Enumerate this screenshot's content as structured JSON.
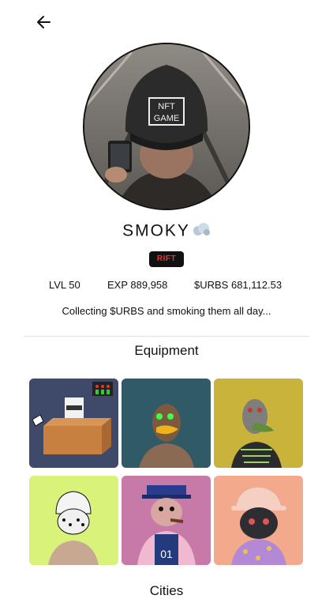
{
  "header": {
    "back_icon": "arrow-left-icon"
  },
  "profile": {
    "avatar_text": "NFT GAME",
    "username": "SMOKY",
    "username_icon": "smoke-cloud-icon",
    "badge": "RIFT",
    "badge_color": "#e53935",
    "level": "LVL 50",
    "exp": "EXP 889,958",
    "urbs": "$URBS 681,112.53",
    "bio": "Collecting $URBS and smoking them all day..."
  },
  "equipment": {
    "title": "Equipment",
    "items": [
      {
        "name": "box-robot-nft",
        "bg": "#3f4a6b"
      },
      {
        "name": "duck-nft-green-eyes",
        "bg": "#2f5a66"
      },
      {
        "name": "zombie-duck-nft",
        "bg": "#c9b33a"
      },
      {
        "name": "bandana-duck-nft",
        "bg": "#d8f27a"
      },
      {
        "name": "captain-duck-nft",
        "bg": "#c77aa8"
      },
      {
        "name": "cat-bucket-hat-nft",
        "bg": "#f2a98c"
      }
    ]
  },
  "cities": {
    "title": "Cities"
  }
}
